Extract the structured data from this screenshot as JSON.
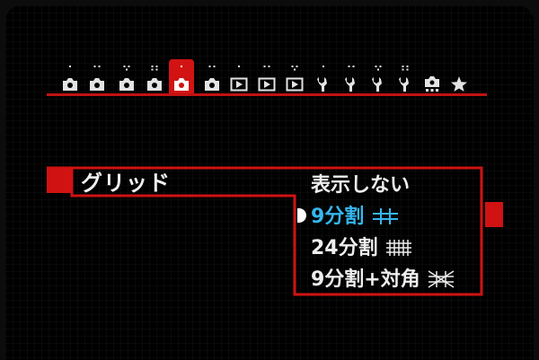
{
  "menu": {
    "tabs": [
      {
        "name": "shooting-tab-1",
        "icon": "camera-icon",
        "dots": 1,
        "active": false
      },
      {
        "name": "shooting-tab-2",
        "icon": "camera-icon",
        "dots": 2,
        "active": false
      },
      {
        "name": "shooting-tab-3",
        "icon": "camera-icon",
        "dots": 3,
        "active": false
      },
      {
        "name": "shooting-tab-4",
        "icon": "camera-icon",
        "dots": 4,
        "active": false
      },
      {
        "name": "live-view-tab-1",
        "icon": "camera-icon",
        "dots": 1,
        "active": true
      },
      {
        "name": "live-view-tab-2",
        "icon": "camera-icon",
        "dots": 2,
        "active": false
      },
      {
        "name": "playback-tab-1",
        "icon": "playback-icon",
        "dots": 1,
        "active": false
      },
      {
        "name": "playback-tab-2",
        "icon": "playback-icon",
        "dots": 2,
        "active": false
      },
      {
        "name": "playback-tab-3",
        "icon": "playback-icon",
        "dots": 3,
        "active": false
      },
      {
        "name": "setup-tab-1",
        "icon": "wrench-icon",
        "dots": 1,
        "active": false
      },
      {
        "name": "setup-tab-2",
        "icon": "wrench-icon",
        "dots": 2,
        "active": false
      },
      {
        "name": "setup-tab-3",
        "icon": "wrench-icon",
        "dots": 3,
        "active": false
      },
      {
        "name": "setup-tab-4",
        "icon": "wrench-icon",
        "dots": 4,
        "active": false
      },
      {
        "name": "custom-function-tab",
        "icon": "custom-camera-icon",
        "dots": 0,
        "active": false
      },
      {
        "name": "my-menu-tab",
        "icon": "star-icon",
        "dots": 0,
        "active": false
      }
    ],
    "accent_color": "#d21313",
    "selected_color": "#35b7ee"
  },
  "setting": {
    "label": "グリッド",
    "options": [
      {
        "label": "表示しない",
        "grid_icon": "",
        "selected": false
      },
      {
        "label": "9分割",
        "grid_icon": "grid-3x3-icon",
        "selected": true
      },
      {
        "label": "24分割",
        "grid_icon": "grid-6x4-icon",
        "selected": false
      },
      {
        "label": "9分割+対角",
        "grid_icon": "grid-diagonal-icon",
        "selected": false
      }
    ]
  }
}
